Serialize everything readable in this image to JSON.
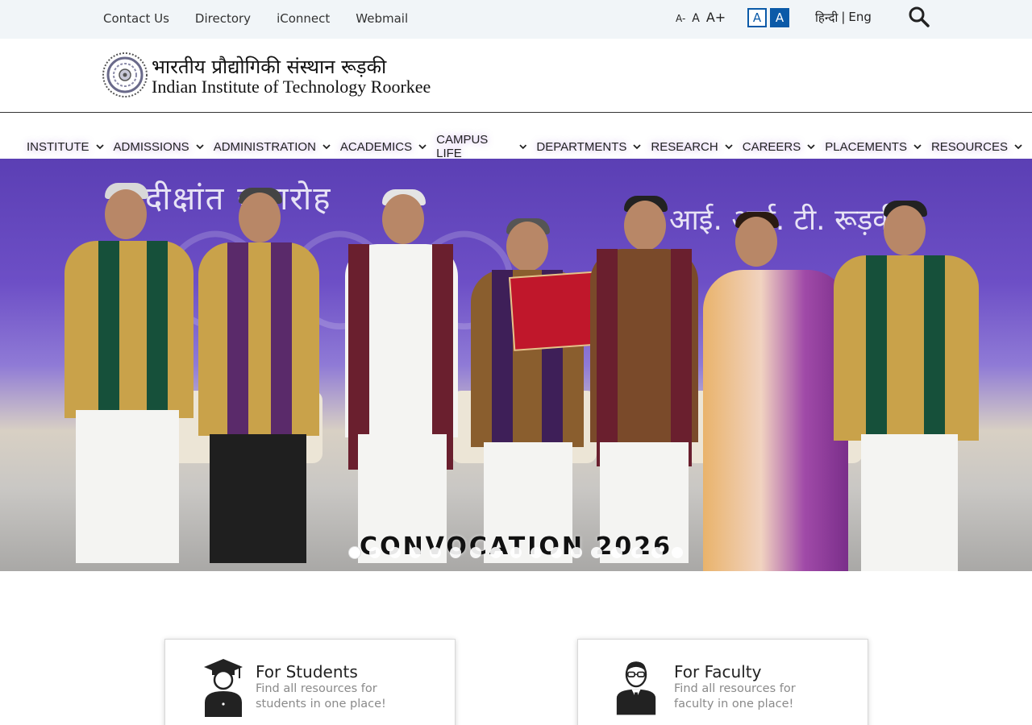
{
  "topbar": {
    "links": [
      "Contact Us",
      "Directory",
      "iConnect",
      "Webmail"
    ],
    "font_controls": {
      "smaller": "A-",
      "normal": "A",
      "larger": "A+"
    },
    "contrast": {
      "light": "A",
      "dark": "A"
    },
    "language": {
      "hindi": "हिन्दी",
      "separator": "|",
      "english": "Eng"
    }
  },
  "logo": {
    "hindi": "भारतीय प्रौद्योगिकी संस्थान रूड़की",
    "english": "Indian Institute of Technology Roorkee"
  },
  "nav": {
    "items": [
      "INSTITUTE",
      "ADMISSIONS",
      "ADMINISTRATION",
      "ACADEMICS",
      "CAMPUS LIFE",
      "DEPARTMENTS",
      "RESEARCH",
      "CAREERS",
      "PLACEMENTS",
      "RESOURCES"
    ]
  },
  "hero": {
    "caption": "CONVOCATION 2026",
    "banner_hindi_left": "दीक्षांत समारोह",
    "banner_hindi_right": "आई. आई. टी. रूड़की",
    "slide_count": 17,
    "active_slide": 1
  },
  "cards": {
    "students": {
      "title": "For Students",
      "desc": "Find all resources for students in one place!"
    },
    "faculty": {
      "title": "For Faculty",
      "desc": "Find all resources for faculty in one place!"
    }
  },
  "colors": {
    "accent": "#0b5aa8",
    "topbar_bg": "#f1f5f8",
    "hero_purple": "#6d4fc6"
  }
}
